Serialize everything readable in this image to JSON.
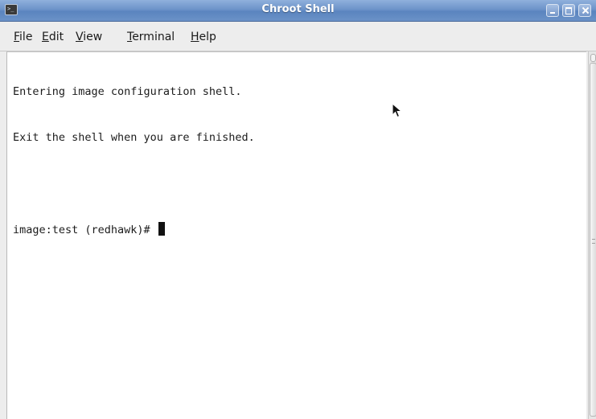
{
  "window": {
    "title": "Chroot Shell",
    "app_icon": "terminal-icon",
    "controls": [
      "minimize-icon",
      "maximize-icon",
      "close-icon"
    ]
  },
  "menubar": {
    "items": [
      {
        "label": "File",
        "mnemonic": "F",
        "rest": "ile"
      },
      {
        "label": "Edit",
        "mnemonic": "E",
        "rest": "dit"
      },
      {
        "label": "View",
        "mnemonic": "V",
        "rest": "iew"
      },
      {
        "label": "Terminal",
        "mnemonic": "T",
        "rest": "erminal"
      },
      {
        "label": "Help",
        "mnemonic": "H",
        "rest": "elp"
      }
    ]
  },
  "terminal": {
    "lines": [
      "Entering image configuration shell.",
      "Exit the shell when you are finished.",
      "",
      "image:test (redhawk)# "
    ],
    "background": "#ffffff",
    "foreground": "#1c1c1c",
    "cursor": "block-cursor"
  },
  "colors": {
    "titlebar": "#6c93c9",
    "title_text": "#ffffff",
    "menubar": "#ededed"
  }
}
